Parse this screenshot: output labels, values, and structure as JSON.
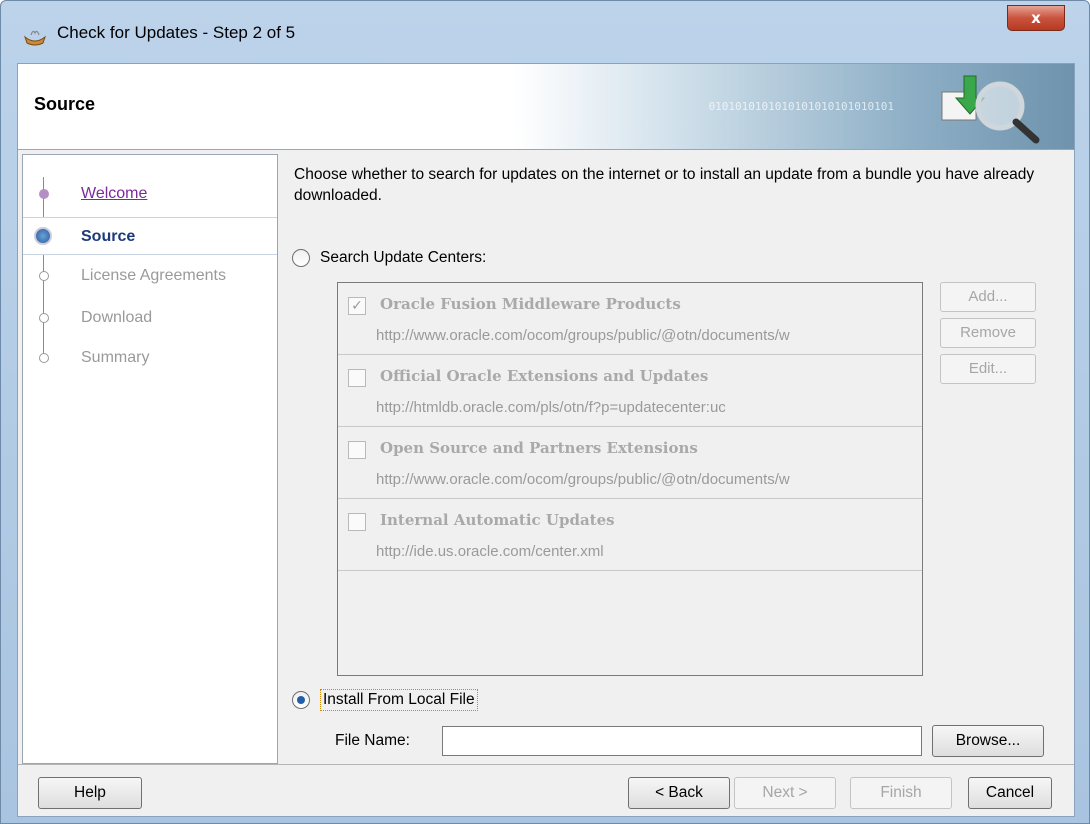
{
  "window": {
    "title": "Check for Updates - Step 2 of 5",
    "close_label": "x"
  },
  "header": {
    "title": "Source",
    "binary_decoration": "0101010101010101010101010101"
  },
  "nav": {
    "items": [
      {
        "label": "Welcome"
      },
      {
        "label": "Source"
      },
      {
        "label": "License Agreements"
      },
      {
        "label": "Download"
      },
      {
        "label": "Summary"
      }
    ]
  },
  "main": {
    "description": "Choose whether to search for updates on the internet or to install an update from a bundle you have already downloaded.",
    "search_radio_label": "Search Update Centers:",
    "search_radio_selected": false,
    "update_centers": [
      {
        "name": "Oracle Fusion Middleware Products",
        "url": "http://www.oracle.com/ocom/groups/public/@otn/documents/w",
        "checked": true,
        "check_glyph": "✓"
      },
      {
        "name": "Official Oracle Extensions and Updates",
        "url": "http://htmldb.oracle.com/pls/otn/f?p=updatecenter:uc",
        "checked": false,
        "check_glyph": ""
      },
      {
        "name": "Open Source and Partners Extensions",
        "url": "http://www.oracle.com/ocom/groups/public/@otn/documents/w",
        "checked": false,
        "check_glyph": ""
      },
      {
        "name": "Internal Automatic Updates",
        "url": "http://ide.us.oracle.com/center.xml",
        "checked": false,
        "check_glyph": ""
      }
    ],
    "side_buttons": {
      "add": "Add...",
      "remove": "Remove",
      "edit": "Edit..."
    },
    "local_radio_label": "Install From Local File",
    "local_radio_selected": true,
    "file_name_label": "File Name:",
    "file_name_value": "",
    "browse_label": "Browse..."
  },
  "footer": {
    "help": "Help",
    "back": "< Back",
    "next": "Next >",
    "finish": "Finish",
    "cancel": "Cancel"
  },
  "colors": {
    "accent_radio": "#2160a8",
    "nav_visited": "#7a2a9a",
    "nav_current": "#1f3a7a",
    "close_button": "#c9533d"
  }
}
